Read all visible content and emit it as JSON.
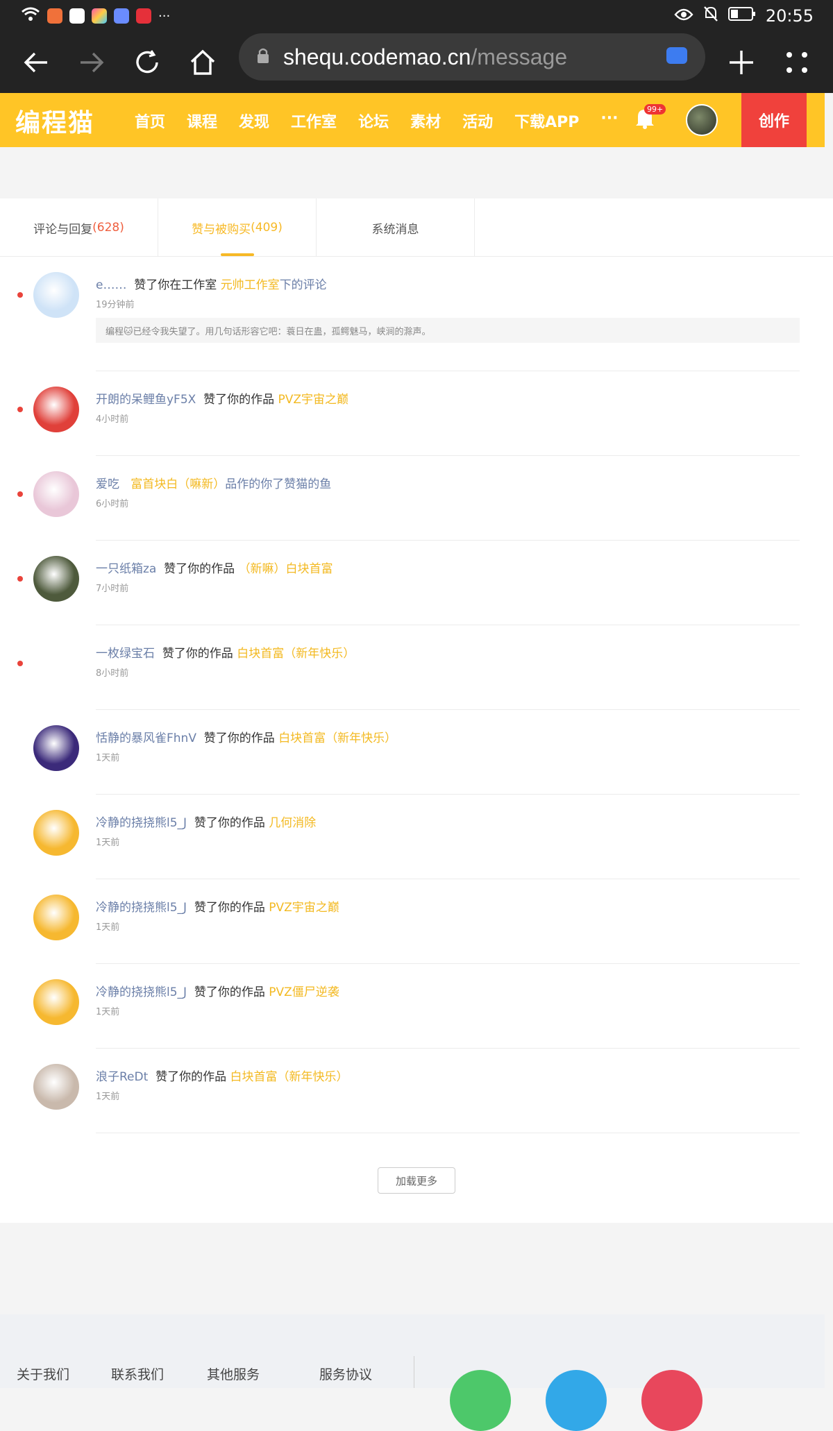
{
  "status_bar": {
    "time": "20:55",
    "more": "···"
  },
  "browser": {
    "url_host": "shequ.codemao.cn",
    "url_path": "/message"
  },
  "site": {
    "logo": "编程猫",
    "menu": [
      "首页",
      "课程",
      "发现",
      "工作室",
      "论坛",
      "素材",
      "活动",
      "下载APP",
      "···"
    ],
    "bell_badge": "99+",
    "create_label": "创作"
  },
  "tabs": [
    {
      "label": "评论与回复",
      "count": "(628)"
    },
    {
      "label": "赞与被购买",
      "count": "(409)"
    },
    {
      "label": "系统消息",
      "count": ""
    }
  ],
  "messages": [
    {
      "user": "e……",
      "action": "赞了你在工作室",
      "work": "元帅工作室",
      "suffix": "下的评论",
      "time": "19分钟前",
      "quote": "编程🐱已经令我失望了。用几句话形容它吧：蓑日在蛊，孤鳄魅马，峡涧的滁声。",
      "unread": true,
      "avatar_color": "#cfe3f7"
    },
    {
      "user": "开朗的呆鲤鱼yF5X",
      "action": "赞了你的作品",
      "work": "PVZ宇宙之巅",
      "suffix": "",
      "time": "4小时前",
      "unread": true,
      "avatar_color": "#e0403a"
    },
    {
      "user": "爱吃",
      "action": "",
      "work": "富首块白（嘛新）",
      "suffix": "品作的你了赞猫的鱼",
      "time": "6小时前",
      "unread": true,
      "avatar_color": "#e9c7d8"
    },
    {
      "user": "一只纸箱za",
      "action": "赞了你的作品",
      "work": "（新嘛）白块首富",
      "suffix": "",
      "time": "7小时前",
      "unread": true,
      "avatar_color": "#4e5a3c"
    },
    {
      "user": "一枚绿宝石",
      "action": "赞了你的作品",
      "work": "白块首富（新年快乐）",
      "suffix": "",
      "time": "8小时前",
      "unread": true,
      "avatar_color": "#ffffff"
    },
    {
      "user": "恬静的暴风雀FhnV",
      "action": "赞了你的作品",
      "work": "白块首富（新年快乐）",
      "suffix": "",
      "time": "1天前",
      "unread": false,
      "avatar_color": "#3b2a7a"
    },
    {
      "user": "冷静的挠挠熊l5_J",
      "action": "赞了你的作品",
      "work": "几何消除",
      "suffix": "",
      "time": "1天前",
      "unread": false,
      "avatar_color": "#f6b830"
    },
    {
      "user": "冷静的挠挠熊l5_J",
      "action": "赞了你的作品",
      "work": "PVZ宇宙之巅",
      "suffix": "",
      "time": "1天前",
      "unread": false,
      "avatar_color": "#f6b830"
    },
    {
      "user": "冷静的挠挠熊l5_J",
      "action": "赞了你的作品",
      "work": "PVZ僵尸逆袭",
      "suffix": "",
      "time": "1天前",
      "unread": false,
      "avatar_color": "#f6b830"
    },
    {
      "user": "浪子ReDt",
      "action": "赞了你的作品",
      "work": "白块首富（新年快乐）",
      "suffix": "",
      "time": "1天前",
      "unread": false,
      "avatar_color": "#c9b9ac"
    }
  ],
  "load_more": "加载更多",
  "footer": {
    "links": [
      "关于我们",
      "联系我们",
      "其他服务",
      "服务协议"
    ]
  }
}
